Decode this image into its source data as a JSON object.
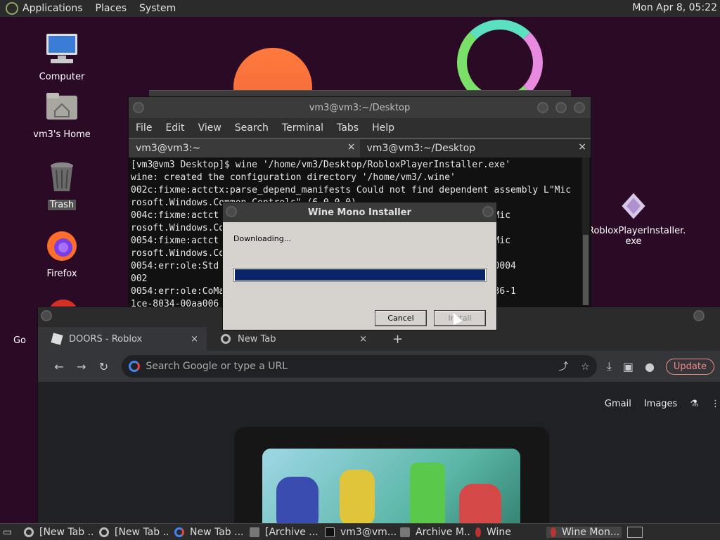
{
  "top_panel": {
    "menus": [
      "Applications",
      "Places",
      "System"
    ],
    "clock": "Mon Apr  8, 05:22"
  },
  "desktop": {
    "icons": [
      {
        "label": "Computer"
      },
      {
        "label": "vm3's Home"
      },
      {
        "label": "Trash"
      },
      {
        "label": "Firefox"
      },
      {
        "label": "Go"
      },
      {
        "label": "RobloxPlayerInstaller.\nexe"
      }
    ]
  },
  "terminal": {
    "title": "vm3@vm3:~/Desktop",
    "menu": [
      "File",
      "Edit",
      "View",
      "Search",
      "Terminal",
      "Tabs",
      "Help"
    ],
    "tabs": [
      {
        "label": "vm3@vm3:~",
        "close": "×"
      },
      {
        "label": "vm3@vm3:~/Desktop",
        "close": "×"
      }
    ],
    "output": "[vm3@vm3 Desktop]$ wine '/home/vm3/Desktop/RobloxPlayerInstaller.exe'\nwine: created the configuration directory '/home/vm3/.wine'\n002c:fixme:actctx:parse_depend_manifests Could not find dependent assembly L\"Mic\nrosoft.Windows.Common-Controls\" (6.0.0.0)\n004c:fixme:actct                                       assembly L\"Mic\nrosoft.Windows.Co\n0054:fixme:actct                                       assembly L\"Mic\nrosoft.Windows.Co\n0054:err:ole:Std                                       tub, hr 0x80004\n002\n0054:err:ole:CoMa                                      6d5140c1-7436-1\n1ce-8034-00aa006"
  },
  "dialog": {
    "title": "Wine Mono Installer",
    "message": "Downloading...",
    "progress": 1.0,
    "cancel_label": "Cancel",
    "install_label": "Install"
  },
  "chrome": {
    "tabs": [
      {
        "label": "DOORS    - Roblox",
        "close": "×"
      },
      {
        "label": "New Tab",
        "close": "×"
      }
    ],
    "new_tab": "+",
    "omnibox_placeholder": "Search Google or type a URL",
    "update_label": "Update",
    "links": [
      "Gmail",
      "Images"
    ]
  },
  "taskbar": {
    "items": [
      {
        "label": "[New Tab ..."
      },
      {
        "label": "[New Tab ..."
      },
      {
        "label": "New Tab ..."
      },
      {
        "label": "[Archive ..."
      },
      {
        "label": "vm3@vm..."
      },
      {
        "label": "Archive M..."
      },
      {
        "label": "Wine"
      },
      {
        "label": "Wine Mon..."
      }
    ]
  },
  "colors": {
    "desktop_bg": "#2a0a24",
    "progress_fill": "#0a246a",
    "update_accent": "#f28b82"
  }
}
